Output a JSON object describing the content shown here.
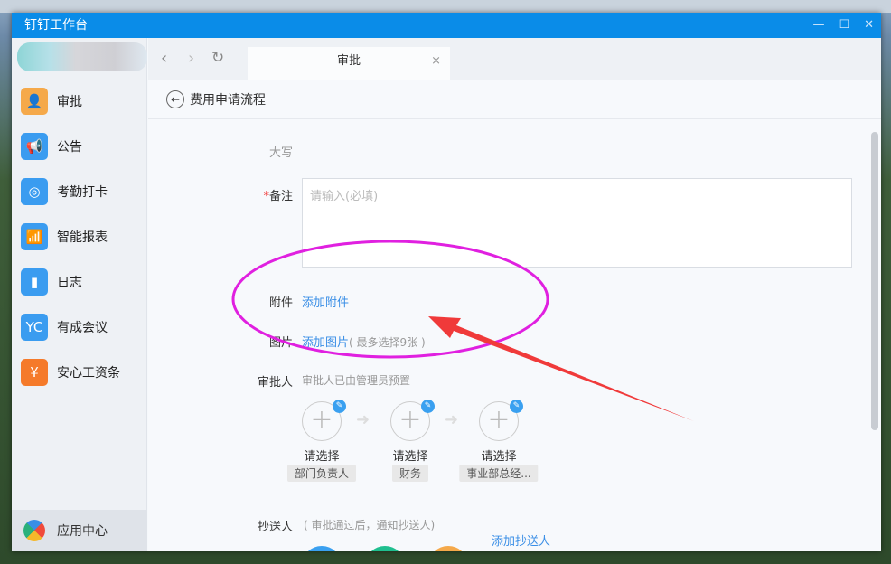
{
  "window": {
    "title": "钉钉工作台"
  },
  "sidebar": {
    "items": [
      {
        "label": "审批",
        "color": "#f5a94a",
        "icon": "stamp-icon"
      },
      {
        "label": "公告",
        "color": "#3a9cf0",
        "icon": "megaphone-icon"
      },
      {
        "label": "考勤打卡",
        "color": "#3a9cf0",
        "icon": "location-icon"
      },
      {
        "label": "智能报表",
        "color": "#3a9cf0",
        "icon": "chart-icon"
      },
      {
        "label": "日志",
        "color": "#3a9cf0",
        "icon": "notebook-icon"
      },
      {
        "label": "有成会议",
        "color": "#3a9cf0",
        "icon": "meeting-icon"
      },
      {
        "label": "安心工资条",
        "color": "#f57a2a",
        "icon": "payslip-icon"
      }
    ],
    "bottom": {
      "label": "应用中心"
    }
  },
  "tab": {
    "label": "审批"
  },
  "page": {
    "title": "费用申请流程"
  },
  "form": {
    "daxie_label": "大写",
    "remark_label": "备注",
    "remark_placeholder": "请输入(必填)",
    "attach_label": "附件",
    "attach_link": "添加附件",
    "image_label": "图片",
    "image_link": "添加图片",
    "image_hint": "( 最多选择9张 )",
    "approver_label": "审批人",
    "approver_hint": "审批人已由管理员预置",
    "approvers": [
      {
        "select": "请选择",
        "role": "部门负责人"
      },
      {
        "select": "请选择",
        "role": "财务"
      },
      {
        "select": "请选择",
        "role": "事业部总经..."
      }
    ],
    "cc_label": "抄送人",
    "cc_hint": "( 审批通过后，通知抄送人)",
    "cc_add": "添加抄送人",
    "cc_colors": [
      "#3aa0f0",
      "#1fbf8f",
      "#f5a94a"
    ]
  },
  "annotation_colors": {
    "ellipse": "#e020e0",
    "arrow": "#f03a3a"
  }
}
